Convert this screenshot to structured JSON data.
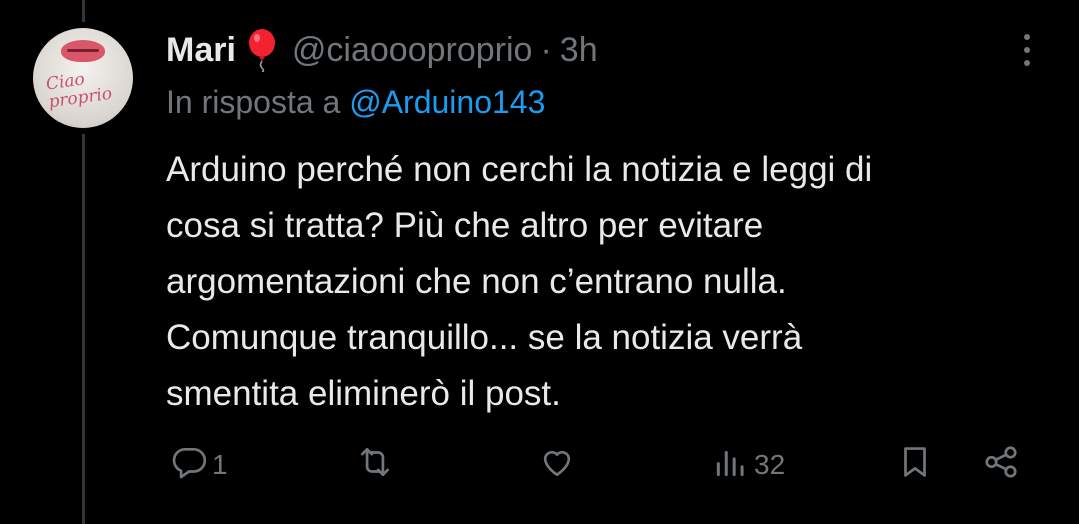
{
  "tweet": {
    "author_name": "Mari",
    "author_emoji": "balloon",
    "handle": "@ciaoooproprio",
    "separator": "·",
    "time": "3h",
    "reply_prefix": "In risposta a",
    "reply_to": "@Arduino143",
    "text": "Arduino perché non cerchi la notizia e leggi di\ncosa si tratta? Più che altro per evitare\nargomentazioni che non c’entrano nulla.\nComunque tranquillo... se la notizia verrà\nsmentita eliminerò il post.",
    "avatar_text": "Ciao\nproprio"
  },
  "actions": {
    "reply_count": "1",
    "retweet_count": "",
    "like_count": "",
    "views_count": "32"
  },
  "icons": {
    "more": "more-vertical-icon",
    "reply": "reply-icon",
    "retweet": "retweet-icon",
    "like": "heart-icon",
    "views": "views-icon",
    "bookmark": "bookmark-icon",
    "share": "share-icon"
  },
  "colors": {
    "background": "#000000",
    "text": "#e7e9ea",
    "secondary": "#71767b",
    "link": "#1d9bf0",
    "balloon": "#f4212e"
  }
}
